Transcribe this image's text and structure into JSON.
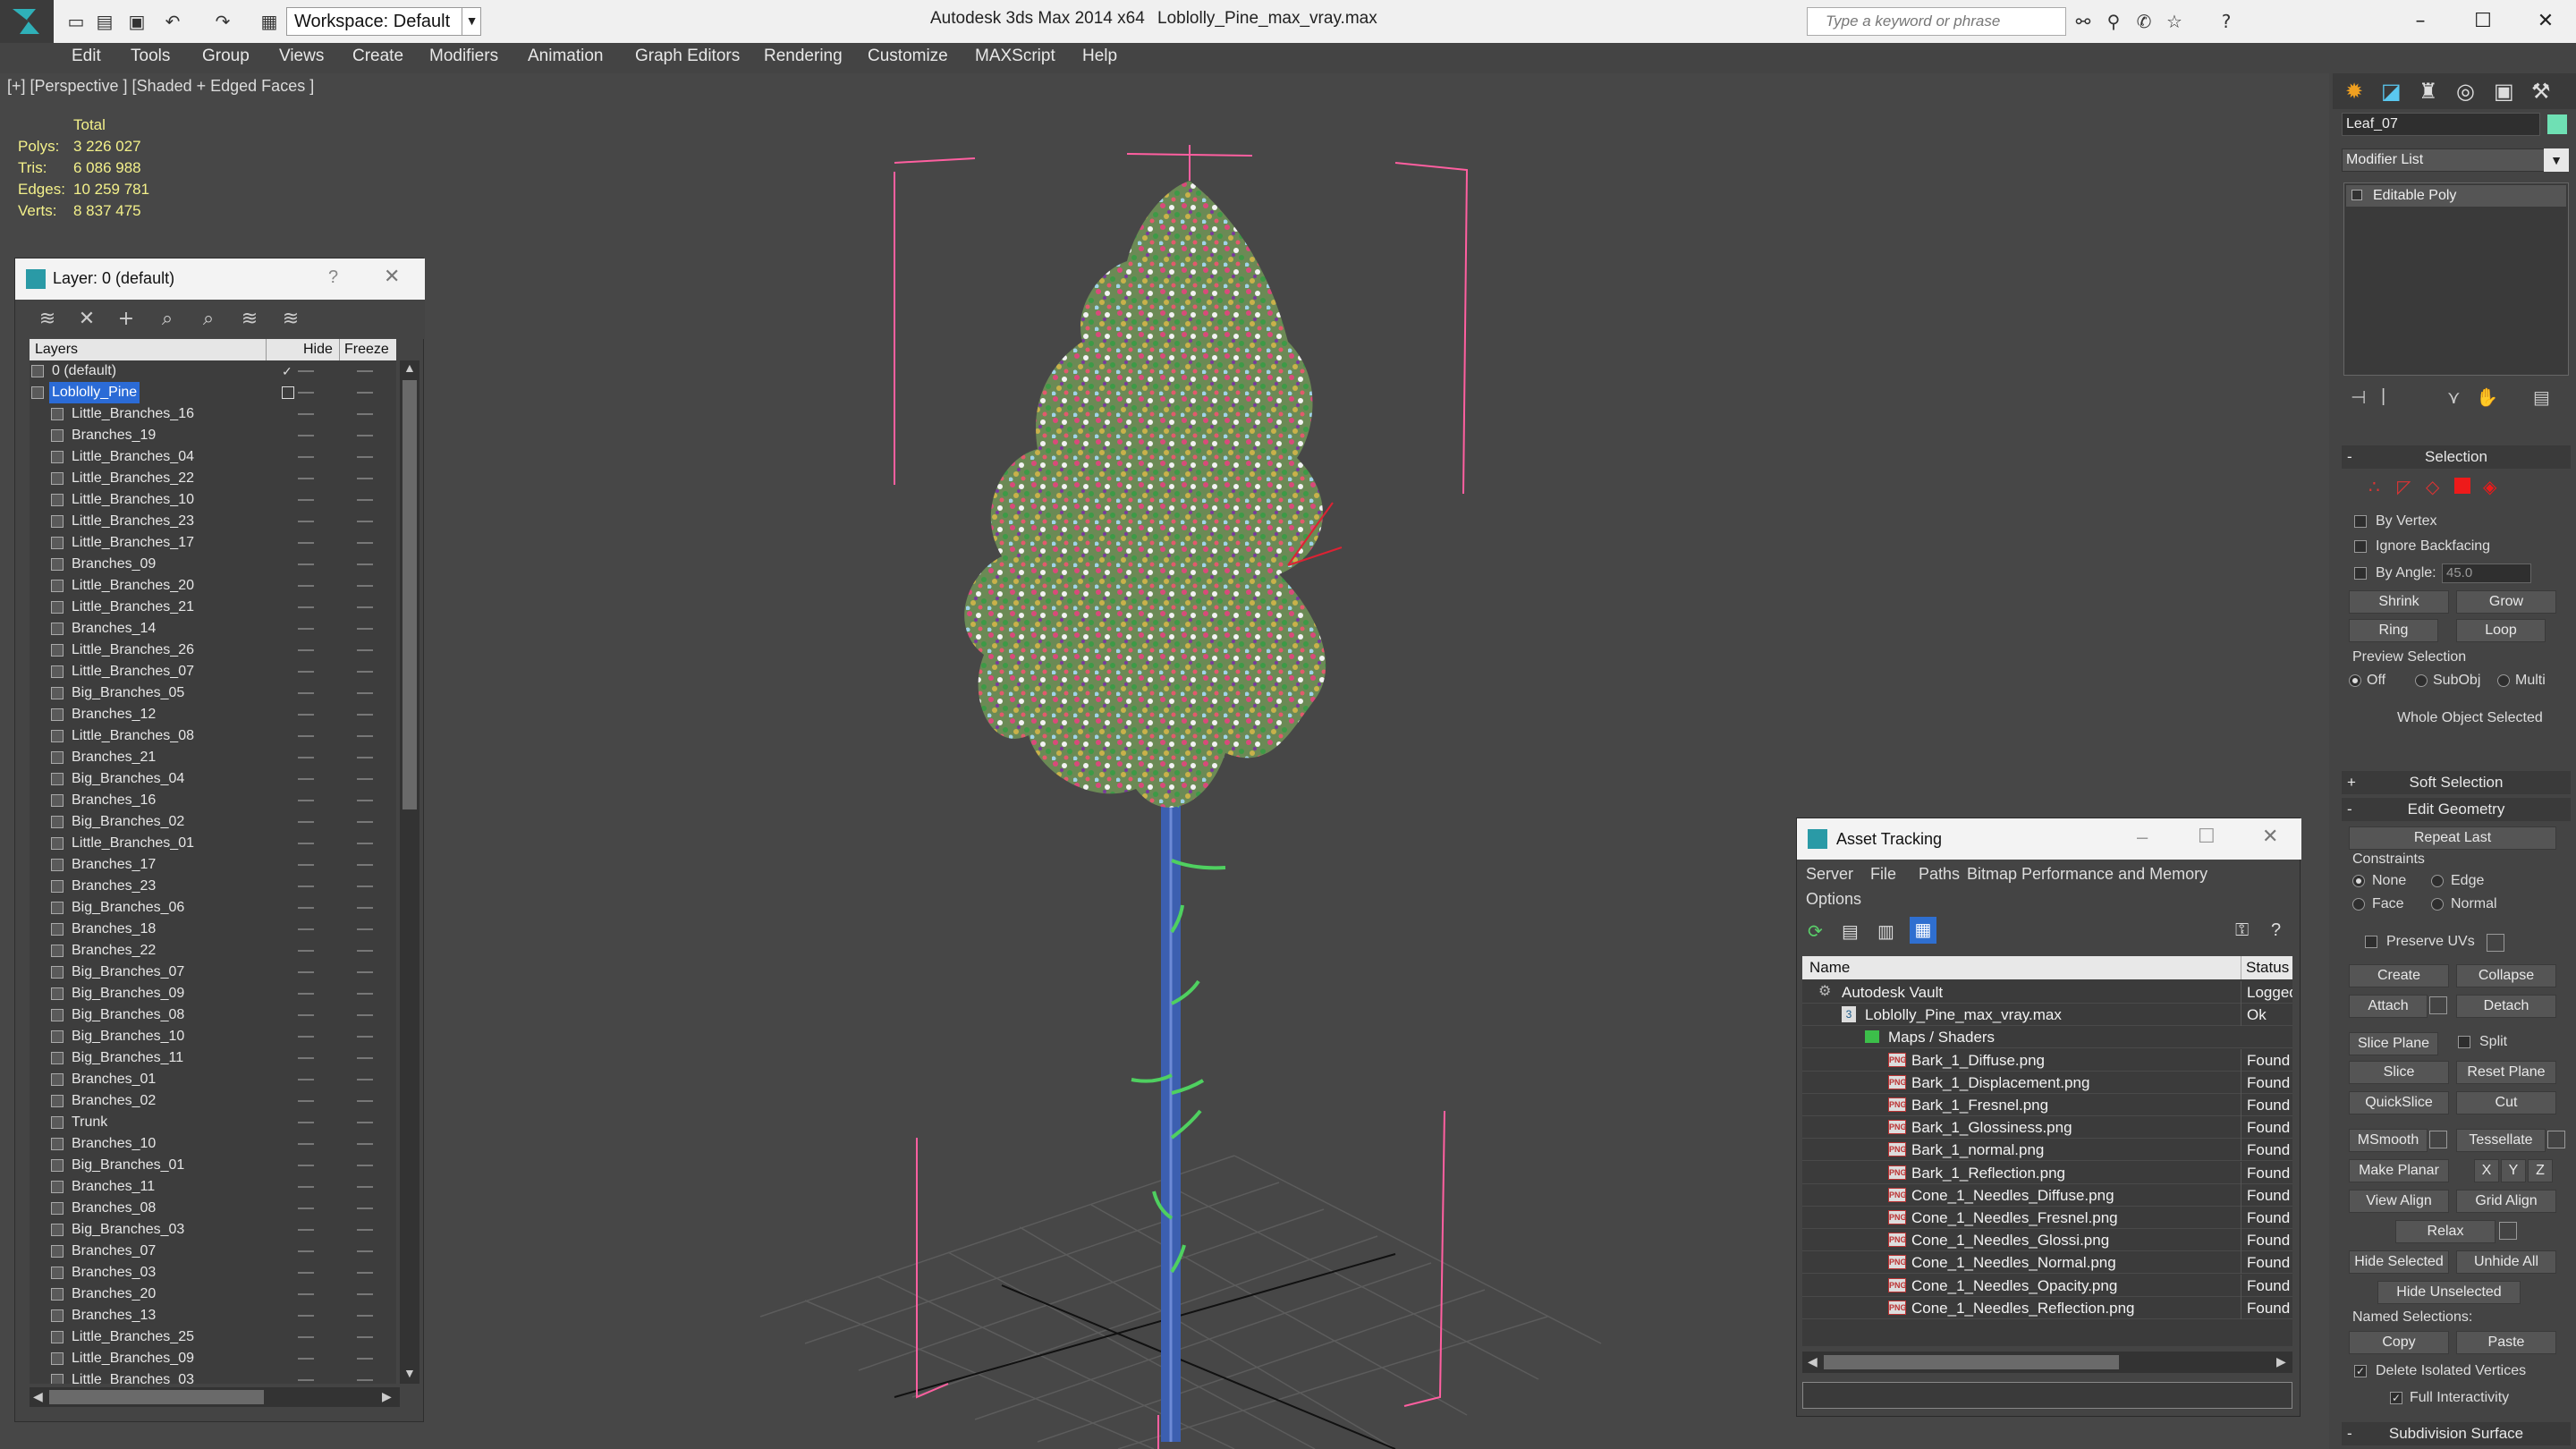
{
  "titlebar": {
    "workspace": "Workspace: Default",
    "app_title": "Autodesk 3ds Max  2014 x64",
    "file_title": "Loblolly_Pine_max_vray.max",
    "search_placeholder": "Type a keyword or phrase"
  },
  "menu": [
    "Edit",
    "Tools",
    "Group",
    "Views",
    "Create",
    "Modifiers",
    "Animation",
    "Graph Editors",
    "Rendering",
    "Customize",
    "MAXScript",
    "Help"
  ],
  "viewport": {
    "label": "[+] [Perspective ] [Shaded + Edged Faces ]",
    "stats_header": "Total",
    "stats": [
      {
        "label": "Polys:",
        "value": "3 226 027"
      },
      {
        "label": "Tris:",
        "value": "6 086 988"
      },
      {
        "label": "Edges:",
        "value": "10 259 781"
      },
      {
        "label": "Verts:",
        "value": "8 837 475"
      }
    ]
  },
  "layer_panel": {
    "title": "Layer: 0 (default)",
    "help": "?",
    "columns": {
      "layers": "Layers",
      "hide": "Hide",
      "freeze": "Freeze"
    },
    "rows": [
      {
        "name": "0 (default)",
        "level": 0,
        "selected": false
      },
      {
        "name": "Loblolly_Pine",
        "level": 0,
        "selected": true
      },
      {
        "name": "Little_Branches_16",
        "level": 1
      },
      {
        "name": "Branches_19",
        "level": 1
      },
      {
        "name": "Little_Branches_04",
        "level": 1
      },
      {
        "name": "Little_Branches_22",
        "level": 1
      },
      {
        "name": "Little_Branches_10",
        "level": 1
      },
      {
        "name": "Little_Branches_23",
        "level": 1
      },
      {
        "name": "Little_Branches_17",
        "level": 1
      },
      {
        "name": "Branches_09",
        "level": 1
      },
      {
        "name": "Little_Branches_20",
        "level": 1
      },
      {
        "name": "Little_Branches_21",
        "level": 1
      },
      {
        "name": "Branches_14",
        "level": 1
      },
      {
        "name": "Little_Branches_26",
        "level": 1
      },
      {
        "name": "Little_Branches_07",
        "level": 1
      },
      {
        "name": "Big_Branches_05",
        "level": 1
      },
      {
        "name": "Branches_12",
        "level": 1
      },
      {
        "name": "Little_Branches_08",
        "level": 1
      },
      {
        "name": "Branches_21",
        "level": 1
      },
      {
        "name": "Big_Branches_04",
        "level": 1
      },
      {
        "name": "Branches_16",
        "level": 1
      },
      {
        "name": "Big_Branches_02",
        "level": 1
      },
      {
        "name": "Little_Branches_01",
        "level": 1
      },
      {
        "name": "Branches_17",
        "level": 1
      },
      {
        "name": "Branches_23",
        "level": 1
      },
      {
        "name": "Big_Branches_06",
        "level": 1
      },
      {
        "name": "Branches_18",
        "level": 1
      },
      {
        "name": "Branches_22",
        "level": 1
      },
      {
        "name": "Big_Branches_07",
        "level": 1
      },
      {
        "name": "Big_Branches_09",
        "level": 1
      },
      {
        "name": "Big_Branches_08",
        "level": 1
      },
      {
        "name": "Big_Branches_10",
        "level": 1
      },
      {
        "name": "Big_Branches_11",
        "level": 1
      },
      {
        "name": "Branches_01",
        "level": 1
      },
      {
        "name": "Branches_02",
        "level": 1
      },
      {
        "name": "Trunk",
        "level": 1
      },
      {
        "name": "Branches_10",
        "level": 1
      },
      {
        "name": "Big_Branches_01",
        "level": 1
      },
      {
        "name": "Branches_11",
        "level": 1
      },
      {
        "name": "Branches_08",
        "level": 1
      },
      {
        "name": "Big_Branches_03",
        "level": 1
      },
      {
        "name": "Branches_07",
        "level": 1
      },
      {
        "name": "Branches_03",
        "level": 1
      },
      {
        "name": "Branches_20",
        "level": 1
      },
      {
        "name": "Branches_13",
        "level": 1
      },
      {
        "name": "Little_Branches_25",
        "level": 1
      },
      {
        "name": "Little_Branches_09",
        "level": 1
      },
      {
        "name": "Little_Branches_03",
        "level": 1
      }
    ]
  },
  "command_panel": {
    "object_name": "Leaf_07",
    "object_color": "#6fe0b4",
    "modifier_list": "Modifier List",
    "stack_item": "Editable Poly",
    "selection": {
      "title": "Selection",
      "by_vertex": "By Vertex",
      "ignore_backfacing": "Ignore Backfacing",
      "by_angle": "By Angle:",
      "angle_value": "45.0",
      "shrink": "Shrink",
      "grow": "Grow",
      "ring": "Ring",
      "loop": "Loop",
      "preview_selection": "Preview Selection",
      "off": "Off",
      "subobj": "SubObj",
      "multi": "Multi",
      "status": "Whole Object Selected"
    },
    "soft_selection": "Soft Selection",
    "edit_geometry": {
      "title": "Edit Geometry",
      "repeat_last": "Repeat Last",
      "constraints": "Constraints",
      "none": "None",
      "edge": "Edge",
      "face": "Face",
      "normal": "Normal",
      "preserve_uvs": "Preserve UVs",
      "create": "Create",
      "collapse": "Collapse",
      "attach": "Attach",
      "detach": "Detach",
      "slice_plane": "Slice Plane",
      "split": "Split",
      "slice": "Slice",
      "reset_plane": "Reset Plane",
      "quickslice": "QuickSlice",
      "cut": "Cut",
      "msmooth": "MSmooth",
      "tessellate": "Tessellate",
      "make_planar": "Make Planar",
      "x": "X",
      "y": "Y",
      "z": "Z",
      "view_align": "View Align",
      "grid_align": "Grid Align",
      "relax": "Relax",
      "hide_selected": "Hide Selected",
      "unhide_all": "Unhide All",
      "hide_unselected": "Hide Unselected",
      "named_selections": "Named Selections:",
      "copy": "Copy",
      "paste": "Paste",
      "delete_isolated": "Delete Isolated Vertices",
      "full_interactivity": "Full Interactivity"
    },
    "subdivision_surface": "Subdivision Surface"
  },
  "asset_tracking": {
    "title": "Asset Tracking",
    "menu": [
      "Server",
      "File",
      "Paths",
      "Bitmap Performance and Memory",
      "Options"
    ],
    "columns": {
      "name": "Name",
      "status": "Status"
    },
    "rows": [
      {
        "name": "Autodesk Vault",
        "status": "Logged",
        "indent": 0,
        "icon": "vault"
      },
      {
        "name": "Loblolly_Pine_max_vray.max",
        "status": "Ok",
        "indent": 1,
        "icon": "max"
      },
      {
        "name": "Maps / Shaders",
        "status": "",
        "indent": 2,
        "icon": "folder"
      },
      {
        "name": "Bark_1_Diffuse.png",
        "status": "Found",
        "indent": 3,
        "icon": "png"
      },
      {
        "name": "Bark_1_Displacement.png",
        "status": "Found",
        "indent": 3,
        "icon": "png"
      },
      {
        "name": "Bark_1_Fresnel.png",
        "status": "Found",
        "indent": 3,
        "icon": "png"
      },
      {
        "name": "Bark_1_Glossiness.png",
        "status": "Found",
        "indent": 3,
        "icon": "png"
      },
      {
        "name": "Bark_1_normal.png",
        "status": "Found",
        "indent": 3,
        "icon": "png"
      },
      {
        "name": "Bark_1_Reflection.png",
        "status": "Found",
        "indent": 3,
        "icon": "png"
      },
      {
        "name": "Cone_1_Needles_Diffuse.png",
        "status": "Found",
        "indent": 3,
        "icon": "png"
      },
      {
        "name": "Cone_1_Needles_Fresnel.png",
        "status": "Found",
        "indent": 3,
        "icon": "png"
      },
      {
        "name": "Cone_1_Needles_Glossi.png",
        "status": "Found",
        "indent": 3,
        "icon": "png"
      },
      {
        "name": "Cone_1_Needles_Normal.png",
        "status": "Found",
        "indent": 3,
        "icon": "png"
      },
      {
        "name": "Cone_1_Needles_Opacity.png",
        "status": "Found",
        "indent": 3,
        "icon": "png"
      },
      {
        "name": "Cone_1_Needles_Reflection.png",
        "status": "Found",
        "indent": 3,
        "icon": "png"
      }
    ]
  }
}
